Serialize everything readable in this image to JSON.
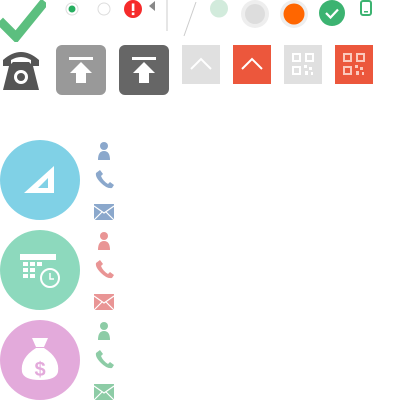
{
  "colors": {
    "check_green": "#5cbf7f",
    "radio_green": "#27ae60",
    "alert_red": "#f52b2b",
    "light_green": "#d2ebdc",
    "ring": "#eeeeee",
    "gray_fill": "#dddddd",
    "orange": "#ff6600",
    "success_green": "#3cb371",
    "phone_dark": "#555555",
    "upload_light": "#999999",
    "upload_dark": "#666666",
    "tile_gray": "#e0e0e0",
    "tile_red": "#ec573c",
    "circle_blue": "#80d1e6",
    "circle_green": "#8dd9bd",
    "circle_pink": "#e3aadb",
    "contact_blue": "#8ba8cc",
    "contact_pink": "#e99595",
    "contact_green": "#8dcca6"
  },
  "icons": [
    "check-icon",
    "radio-selected-icon",
    "radio-empty-icon",
    "alert-icon",
    "triangle-left-icon",
    "divider-line",
    "slash-line",
    "dot-icon",
    "circle-gray-icon",
    "circle-orange-icon",
    "check-circle-icon",
    "mobile-icon",
    "telephone-icon",
    "upload-icon",
    "chevron-up-icon",
    "qr-code-icon",
    "set-square-icon",
    "calendar-clock-icon",
    "money-bag-icon",
    "person-icon",
    "phone-icon",
    "envelope-icon"
  ]
}
